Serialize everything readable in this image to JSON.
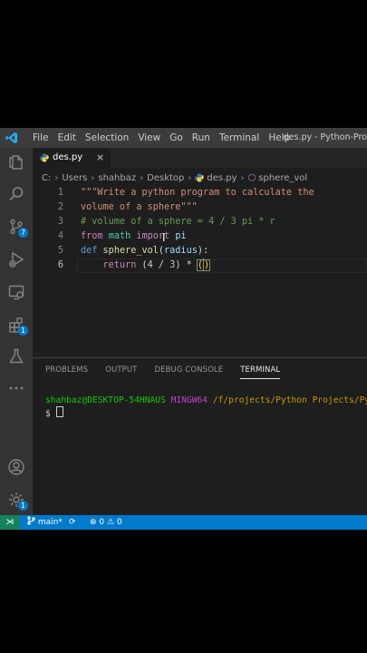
{
  "window": {
    "title": "des.py - Python-Pro",
    "menu": [
      "File",
      "Edit",
      "Selection",
      "View",
      "Go",
      "Run",
      "Terminal",
      "Help"
    ]
  },
  "activity_bar": {
    "items": [
      {
        "name": "explorer",
        "icon": "files-icon"
      },
      {
        "name": "search",
        "icon": "search-icon"
      },
      {
        "name": "source-control",
        "icon": "source-control-icon",
        "badge": "7"
      },
      {
        "name": "run-debug",
        "icon": "run-debug-icon"
      },
      {
        "name": "remote-explorer",
        "icon": "remote-explorer-icon"
      },
      {
        "name": "extensions",
        "icon": "extensions-icon",
        "badge": "1"
      },
      {
        "name": "testing",
        "icon": "flask-icon"
      },
      {
        "name": "more",
        "icon": "ellipsis-icon"
      }
    ],
    "bottom": [
      {
        "name": "accounts",
        "icon": "account-icon"
      },
      {
        "name": "manage",
        "icon": "gear-icon",
        "badge": "1"
      }
    ]
  },
  "tab": {
    "label": "des.py",
    "close": "×"
  },
  "breadcrumb": [
    "C:",
    "Users",
    "shahbaz",
    "Desktop",
    "des.py",
    "sphere_vol"
  ],
  "editor": {
    "lines": [
      {
        "no": "1",
        "tokens": [
          {
            "t": "\"\"\"Write a python program to calculate the",
            "c": "str"
          }
        ]
      },
      {
        "no": "2",
        "tokens": [
          {
            "t": "volume of a sphere\"\"\"",
            "c": "str"
          }
        ]
      },
      {
        "no": "3",
        "tokens": [
          {
            "t": "# volume of a sphere = 4 / 3 pi * r",
            "c": "cmt"
          }
        ]
      },
      {
        "no": "4",
        "tokens": [
          {
            "t": "from",
            "c": "kw"
          },
          {
            "t": " ",
            "c": "op"
          },
          {
            "t": "math",
            "c": "mod"
          },
          {
            "t": " ",
            "c": "op"
          },
          {
            "t": "import",
            "c": "kw"
          },
          {
            "t": " ",
            "c": "op"
          },
          {
            "t": "pi",
            "c": "id"
          }
        ]
      },
      {
        "no": "5",
        "tokens": [
          {
            "t": "def",
            "c": "kw2"
          },
          {
            "t": " ",
            "c": "op"
          },
          {
            "t": "sphere_vol",
            "c": "fn"
          },
          {
            "t": "(",
            "c": "op"
          },
          {
            "t": "radius",
            "c": "id"
          },
          {
            "t": "):",
            "c": "op"
          }
        ]
      },
      {
        "no": "6",
        "tokens": [
          {
            "t": "    ",
            "c": "op"
          },
          {
            "t": "return",
            "c": "kw"
          },
          {
            "t": " (",
            "c": "op"
          },
          {
            "t": "4",
            "c": "num"
          },
          {
            "t": " / ",
            "c": "op"
          },
          {
            "t": "3",
            "c": "num"
          },
          {
            "t": ") * ",
            "c": "op"
          },
          {
            "t": "(",
            "c": "bracket"
          },
          {
            "t": "CURSOR",
            "c": "cursor"
          },
          {
            "t": ")",
            "c": "bracket"
          }
        ]
      }
    ]
  },
  "panel": {
    "tabs": [
      "PROBLEMS",
      "OUTPUT",
      "DEBUG CONSOLE",
      "TERMINAL"
    ],
    "active": "TERMINAL",
    "terminal": {
      "user": "shahbaz@DESKTOP-54HNAUS",
      "shell": "MINGW64",
      "path": "/f/projects/Python Projects/Pytho",
      "prompt": "$"
    }
  },
  "statusbar": {
    "remote": "⋊",
    "branch": "main*",
    "sync": "⟳",
    "errors": "0",
    "warnings": "0"
  },
  "colors": {
    "accent": "#007acc",
    "remote": "#16825d",
    "titlebar": "#3c3c3c",
    "activitybar": "#333333",
    "editor_bg": "#1e1e1e"
  }
}
